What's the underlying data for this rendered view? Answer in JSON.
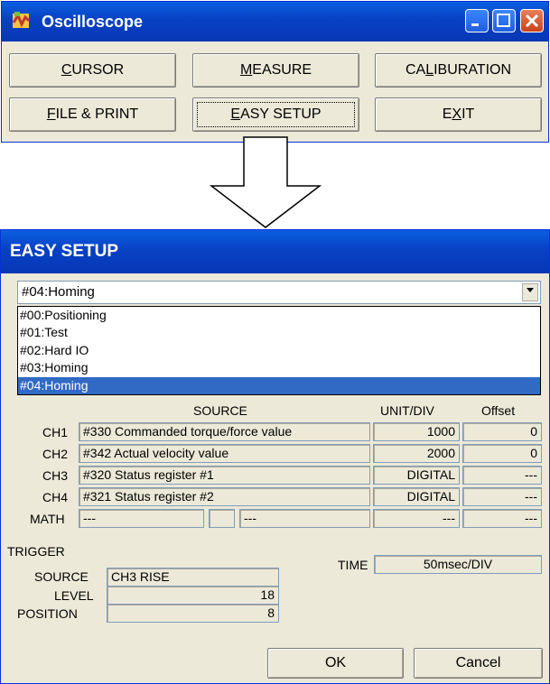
{
  "oscilloscope": {
    "title": "Oscilloscope",
    "buttons": {
      "cursor": {
        "pre": "",
        "u": "C",
        "post": "URSOR"
      },
      "measure": {
        "pre": "",
        "u": "M",
        "post": "EASURE"
      },
      "calibration": {
        "pre": "CA",
        "u": "L",
        "post": "IBURATION"
      },
      "file_print": {
        "pre": "",
        "u": "F",
        "post": "ILE & PRINT"
      },
      "easy_setup": {
        "pre": "",
        "u": "E",
        "post": "ASY SETUP"
      },
      "exit": {
        "pre": "E",
        "u": "X",
        "post": "IT"
      }
    }
  },
  "easy_setup": {
    "title": "EASY SETUP",
    "selected": "#04:Homing",
    "options": [
      "#00:Positioning",
      "#01:Test",
      "#02:Hard IO",
      "#03:Homing",
      "#04:Homing"
    ],
    "headers": {
      "source": "SOURCE",
      "unit": "UNIT/DIV",
      "offset": "Offset"
    },
    "channels": [
      {
        "label": "CH1",
        "source": "#330  Commanded torque/force value",
        "unit": "1000",
        "offset": "0"
      },
      {
        "label": "CH2",
        "source": "#342  Actual velocity value",
        "unit": "2000",
        "offset": "0"
      },
      {
        "label": "CH3",
        "source": "#320  Status register #1",
        "unit": "DIGITAL",
        "offset": "---"
      },
      {
        "label": "CH4",
        "source": "#321  Status register #2",
        "unit": "DIGITAL",
        "offset": "---"
      }
    ],
    "math": {
      "label": "MATH",
      "a": "---",
      "op": "",
      "b": "---",
      "unit": "---",
      "offset": "---"
    },
    "trigger": {
      "title": "TRIGGER",
      "source_label": "SOURCE",
      "source": "CH3 RISE",
      "level_label": "LEVEL",
      "level": "18",
      "position_label": "POSITION",
      "position": "8",
      "time_label": "TIME",
      "time": "50msec/DIV"
    },
    "ok": "OK",
    "cancel": "Cancel"
  }
}
